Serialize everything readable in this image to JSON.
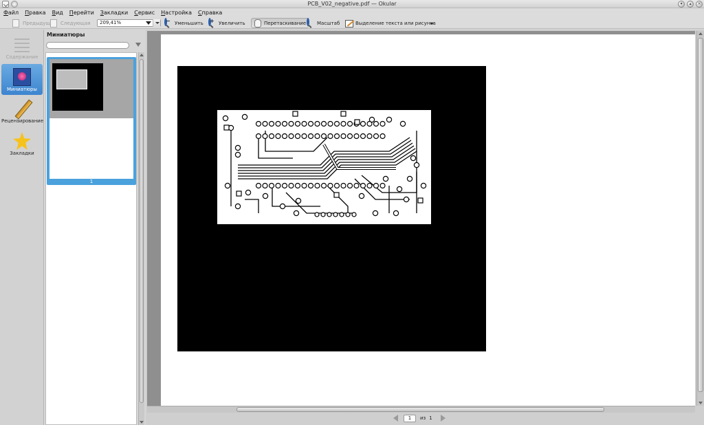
{
  "window": {
    "title": "PCB_V02_negative.pdf — Okular"
  },
  "menu": [
    "Файл",
    "Правка",
    "Вид",
    "Перейти",
    "Закладки",
    "Сервис",
    "Настройка",
    "Справка"
  ],
  "toolbar": {
    "prev_label": "Предыдущая",
    "next_label": "Следующая",
    "zoom_value": "209,41%",
    "zoom_out_label": "Уменьшить",
    "zoom_in_label": "Увеличить",
    "drag_label": "Перетаскивание",
    "zoom_tool_label": "Масштаб",
    "select_label": "Выделение текста или рисунка"
  },
  "sidebar": {
    "items": [
      {
        "label": "Содержание",
        "icon": "toc-icon",
        "state": "disabled"
      },
      {
        "label": "Миниатюры",
        "icon": "thumbnails-icon",
        "state": "active"
      },
      {
        "label": "Рецензирование",
        "icon": "pencil-icon",
        "state": "normal"
      },
      {
        "label": "Закладки",
        "icon": "star-icon",
        "state": "normal"
      }
    ]
  },
  "thumbnails": {
    "title": "Миниатюры",
    "search_value": "",
    "pages": [
      {
        "number": "1",
        "selected": true
      }
    ]
  },
  "pager": {
    "current": "1",
    "of_label": "из",
    "total": "1"
  },
  "colors": {
    "accent": "#4aa1dc",
    "page_background": "#000000",
    "board": "#ffffff"
  }
}
